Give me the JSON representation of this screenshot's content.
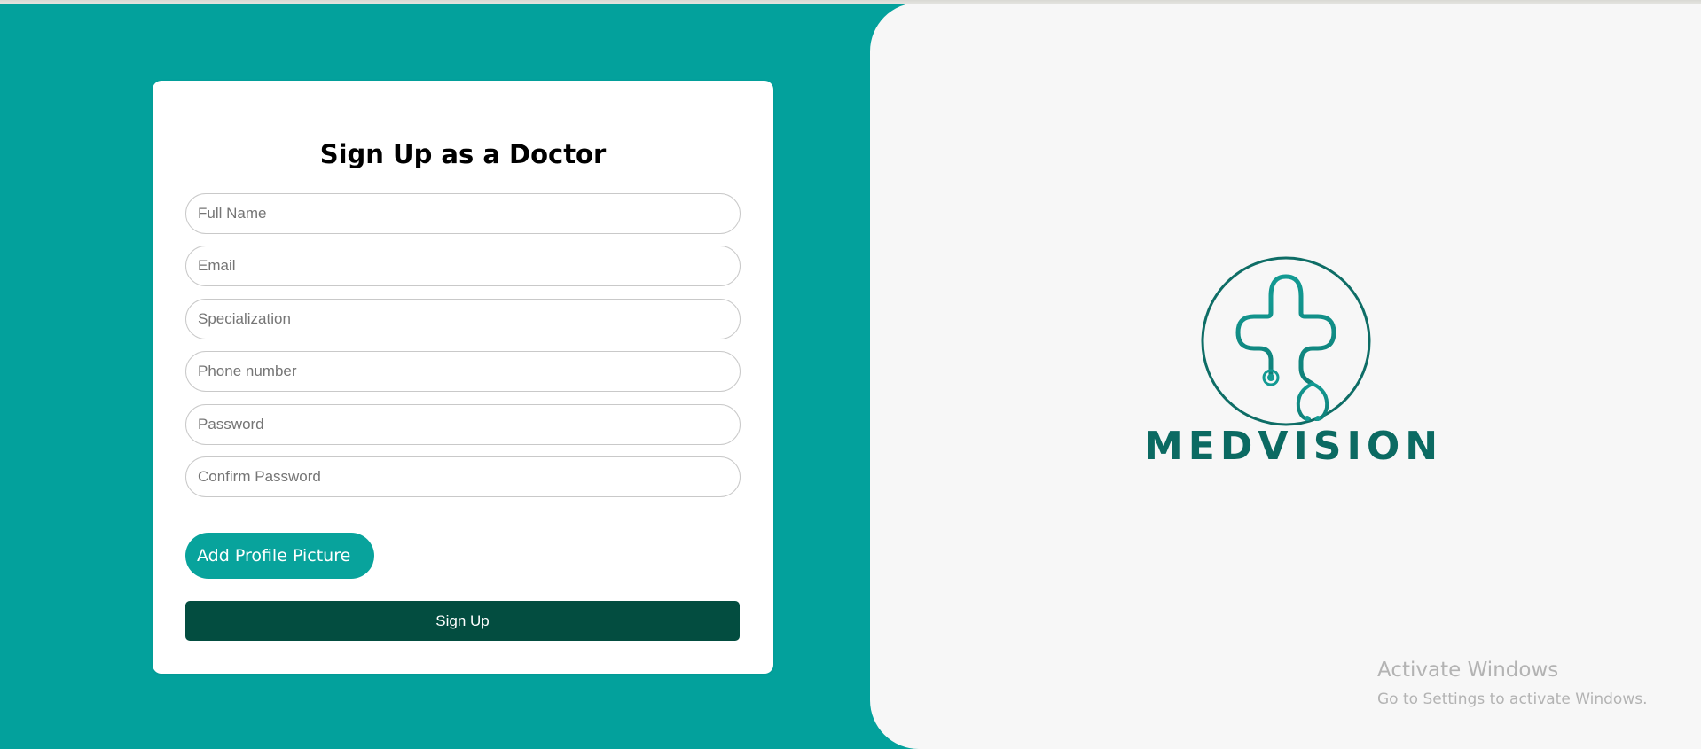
{
  "form": {
    "title": "Sign Up as a Doctor",
    "fields": [
      {
        "placeholder": "Full Name",
        "value": ""
      },
      {
        "placeholder": "Email",
        "value": ""
      },
      {
        "placeholder": "Specialization",
        "value": ""
      },
      {
        "placeholder": "Phone number",
        "value": ""
      },
      {
        "placeholder": "Password",
        "value": ""
      },
      {
        "placeholder": "Confirm Password",
        "value": ""
      }
    ],
    "add_picture_label": "Add Profile Picture",
    "submit_label": "Sign Up"
  },
  "brand": {
    "name": "MEDVISION",
    "logo_icon": "cross-stethoscope-icon"
  },
  "watermark": {
    "title": "Activate Windows",
    "subtitle": "Go to Settings to activate Windows."
  },
  "colors": {
    "background": "#03a19c",
    "panel": "#f7f7f7",
    "accent": "#08a39c",
    "primary_button": "#034d40",
    "brand": "#0b6a62"
  }
}
